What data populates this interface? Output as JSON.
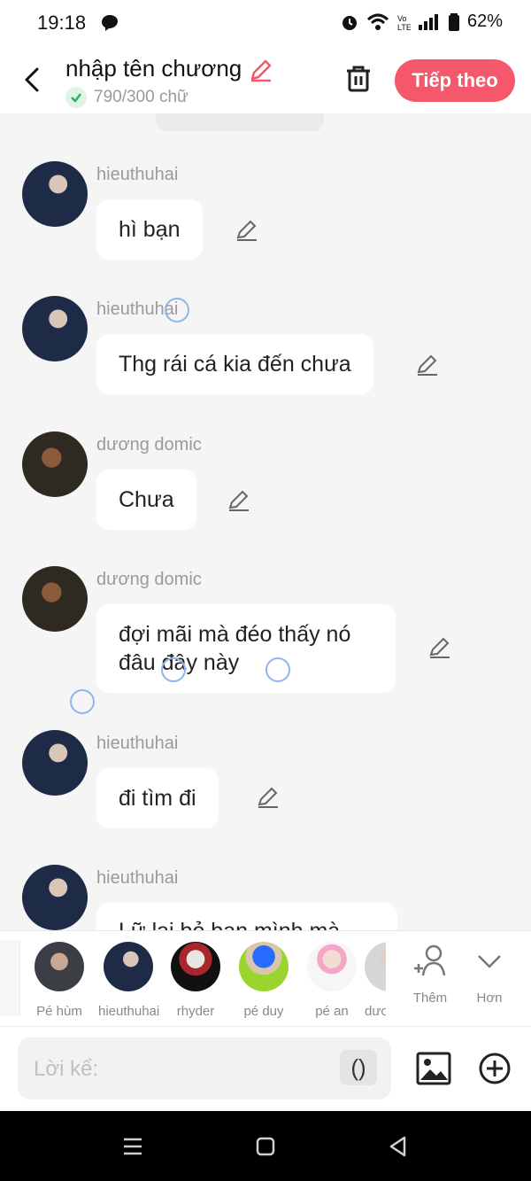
{
  "status": {
    "time": "19:18",
    "battery": "62%"
  },
  "header": {
    "title": "nhập tên chương",
    "word_count": "790/300 chữ",
    "next_label": "Tiếp theo"
  },
  "messages": [
    {
      "name": "hieuthuhai",
      "text": "hì bạn"
    },
    {
      "name": "hieuthuhai",
      "text": "Thg rái cá kia đến chưa"
    },
    {
      "name": "dương domic",
      "text": "Chưa"
    },
    {
      "name": "dương domic",
      "text": "đợi mãi mà đéo thấy nó đâu đây này"
    },
    {
      "name": "hieuthuhai",
      "text": "đi tìm đi"
    },
    {
      "name": "hieuthuhai",
      "text": "Lữ lại bỏ bạn mình mà"
    }
  ],
  "characters": [
    {
      "name": "Pé hùm"
    },
    {
      "name": "hieuthuhai"
    },
    {
      "name": "rhyder"
    },
    {
      "name": "pé duy"
    },
    {
      "name": "pé an"
    },
    {
      "name": "dươ"
    }
  ],
  "actions": {
    "add_label": "Thêm",
    "more_label": "Hơn"
  },
  "input": {
    "placeholder": "Lời kể:",
    "paren_label": "()"
  },
  "colors": {
    "accent": "#f5586b",
    "background": "#f5f5f6"
  }
}
